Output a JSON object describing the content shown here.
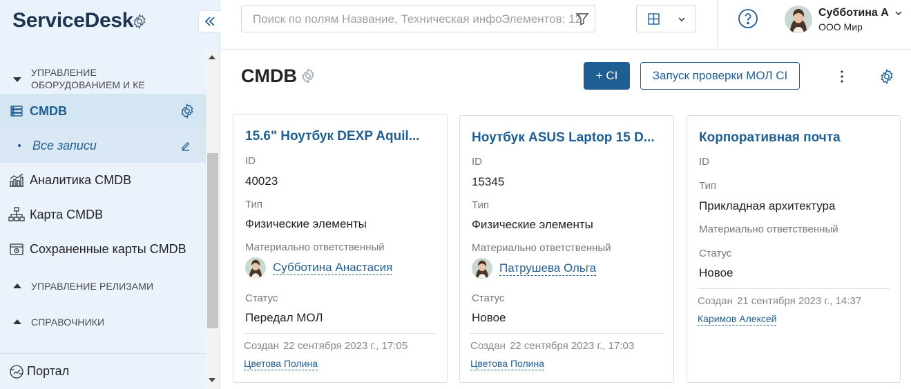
{
  "app": {
    "brand": "ServiceDesk"
  },
  "sidebar": {
    "sections": [
      {
        "label_line1": "УПРАВЛЕНИЕ",
        "label_line2": "ОБОРУДОВАНИЕМ И КЕ",
        "state": "expanded"
      },
      {
        "label": "УПРАВЛЕНИЕ РЕЛИЗАМИ",
        "state": "collapsed"
      },
      {
        "label": "СПРАВОЧНИКИ",
        "state": "collapsed"
      }
    ],
    "items": [
      {
        "label": "CMDB",
        "icon": "server-icon",
        "active": true
      },
      {
        "label": "Все записи",
        "icon": "dot",
        "sub": true
      },
      {
        "label": "Аналитика CMDB",
        "icon": "analytics-icon"
      },
      {
        "label": "Карта CMDB",
        "icon": "hierarchy-icon"
      },
      {
        "label": "Сохраненные карты CMDB",
        "icon": "saved-map-icon"
      }
    ],
    "portal": {
      "label": "Портал",
      "icon": "portal-icon"
    }
  },
  "topbar": {
    "search": {
      "placeholder": "Поиск по полям Название, Техническая инфор",
      "count": "Элементов: 12"
    },
    "user": {
      "name": "Субботина А",
      "org": "ООО Мир"
    }
  },
  "page": {
    "title": "CMDB",
    "add_button": "+ CI",
    "check_button": "Запуск проверки МОЛ CI"
  },
  "cards": [
    {
      "title": "15.6\" Ноутбук DEXP Aquil...",
      "id_label": "ID",
      "id": "40023",
      "type_label": "Тип",
      "type": "Физические элементы",
      "owner_label": "Материально ответственный",
      "owner": "Субботина Анастасия",
      "status_label": "Статус",
      "status": "Передал МОЛ",
      "created_label": "Создан",
      "created": "22 сентября 2023 г., 17:05",
      "creator": "Цветова Полина"
    },
    {
      "title": "Ноутбук ASUS Laptop 15 D...",
      "id_label": "ID",
      "id": "15345",
      "type_label": "Тип",
      "type": "Физические элементы",
      "owner_label": "Материально ответственный",
      "owner": "Патрушева Ольга",
      "status_label": "Статус",
      "status": "Новое",
      "created_label": "Создан",
      "created": "22 сентября 2023 г., 17:03",
      "creator": "Цветова Полина"
    },
    {
      "title": "Корпоративная почта",
      "id_label": "ID",
      "type_label": "Тип",
      "type": "Прикладная архитектура",
      "owner_label": "Материально ответственный",
      "status_label": "Статус",
      "status": "Новое",
      "created_label": "Создан",
      "created": "21 сентября 2023 г., 14:37",
      "creator": "Каримов Алексей"
    }
  ],
  "colors": {
    "accent": "#1f5e92",
    "sidebar_bg": "#eaf3fb",
    "active_bg": "#d5e6f3"
  }
}
